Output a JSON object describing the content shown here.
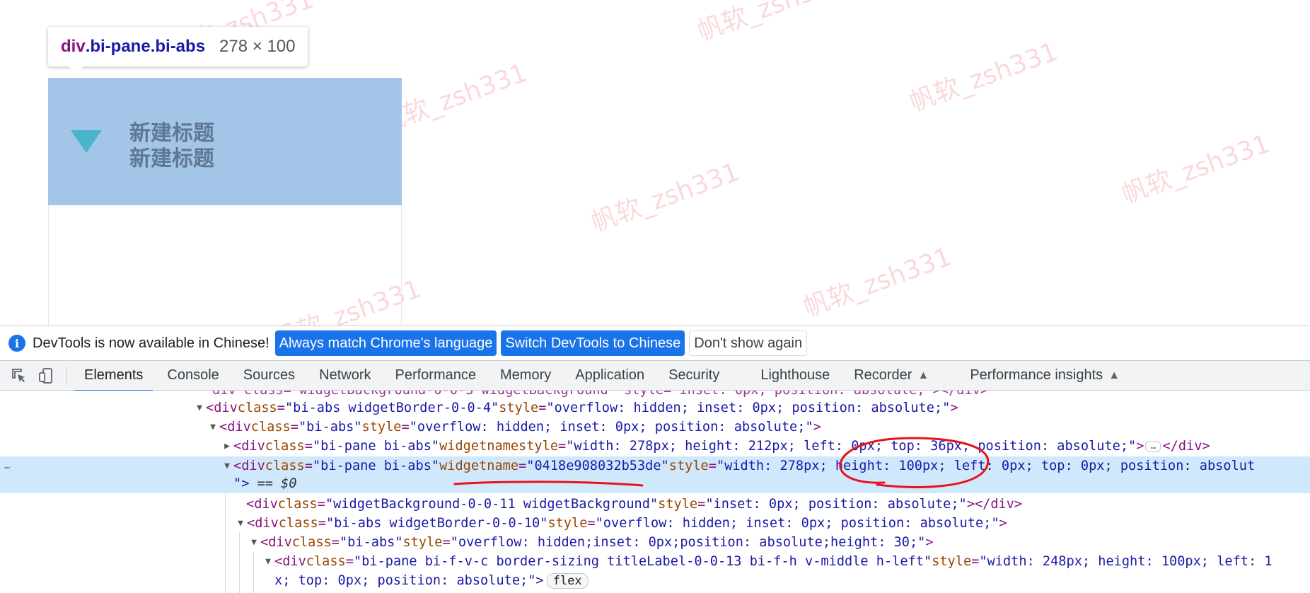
{
  "viewport": {
    "watermark_text": "帆软_zsh331",
    "tooltip": {
      "tag": "div",
      "classes": ".bi-pane.bi-abs",
      "size": "278 × 100"
    },
    "widget": {
      "title_line1": "新建标题",
      "title_line2": "新建标题"
    },
    "colors": {
      "highlight": "#a3c5e8",
      "triangle": "#3eb2c6",
      "title": "#5f7894"
    }
  },
  "infobar": {
    "icon": "info-icon",
    "message": "DevTools is now available in Chinese!",
    "btn_match": "Always match Chrome's language",
    "btn_switch": "Switch DevTools to Chinese",
    "btn_dismiss": "Don't show again"
  },
  "tabbar": {
    "tools": [
      "inspect-element-icon",
      "device-toolbar-icon"
    ],
    "tabs": [
      "Elements",
      "Console",
      "Sources",
      "Network",
      "Performance",
      "Memory",
      "Application",
      "Security",
      "Lighthouse",
      "Recorder",
      "Performance insights"
    ],
    "active_tab": "Elements",
    "experimental_icon": "flask-icon"
  },
  "elements": {
    "line0_partial": "div class=\"widgetBackground-0-0-3 widgetBackground\" style=\"inset: 0px; position: absolute;\"></div>",
    "l1": {
      "tag_open": "<div",
      "attr1_name": "class",
      "attr1_value": "\"bi-abs widgetBorder-0-0-4\"",
      "attr2_name": "style",
      "attr2_value": "\"overflow: hidden; inset: 0px; position: absolute;\"",
      "tag_close": ">"
    },
    "l2": {
      "tag_open": "<div",
      "attr1_name": "class",
      "attr1_value": "\"bi-abs\"",
      "attr2_name": "style",
      "attr2_value": "\"overflow: hidden; inset: 0px; position: absolute;\"",
      "tag_close": ">"
    },
    "l3": {
      "tag_open": "<div",
      "attr1_name": "class",
      "attr1_value": "\"bi-pane bi-abs\"",
      "attr2_name": "widgetname",
      "attr3_name": "style",
      "attr3_value": "\"width: 278px; height: 212px; left: 0px; top: 36px; position: absolute;\"",
      "tag_close": ">",
      "end_tag": "</div>"
    },
    "l4": {
      "tag_open": "<div",
      "attr1_name": "class",
      "attr1_value": "\"bi-pane bi-abs\"",
      "attr2_name": "widgetname",
      "attr2_value": "\"0418e908032b53de\"",
      "attr3_name": "style",
      "attr3_value": "\"width: 278px; height: 100px; left: 0px; top: 0px; position: absolut",
      "cont": "\">",
      "dollar": " == $0"
    },
    "l5": {
      "tag_open": "<div",
      "attr1_name": "class",
      "attr1_value": "\"widgetBackground-0-0-11 widgetBackground\"",
      "attr2_name": "style",
      "attr2_value": "\"inset: 0px; position: absolute;\"",
      "tag_close": "></div>"
    },
    "l6": {
      "tag_open": "<div",
      "attr1_name": "class",
      "attr1_value": "\"bi-abs widgetBorder-0-0-10\"",
      "attr2_name": "style",
      "attr2_value": "\"overflow: hidden; inset: 0px; position: absolute;\"",
      "tag_close": ">"
    },
    "l7": {
      "tag_open": "<div",
      "attr1_name": "class",
      "attr1_value": "\"bi-abs\"",
      "attr2_name": "style",
      "attr2_value": "\"overflow: hidden;inset: 0px;position: absolute;height: 30;\"",
      "tag_close": ">"
    },
    "l8": {
      "tag_open": "<div",
      "attr1_name": "class",
      "attr1_value": "\"bi-pane bi-f-v-c border-sizing titleLabel-0-0-13 bi-f-h v-middle h-left\"",
      "attr2_name": "style",
      "attr2_value": "\"width: 248px; height: 100px; left: 1",
      "cont": "x; top: 0px; position: absolute;\">",
      "badge": "flex"
    },
    "ellipsis": "…",
    "row_menu": "…"
  },
  "annotation_color": "#e8121c"
}
